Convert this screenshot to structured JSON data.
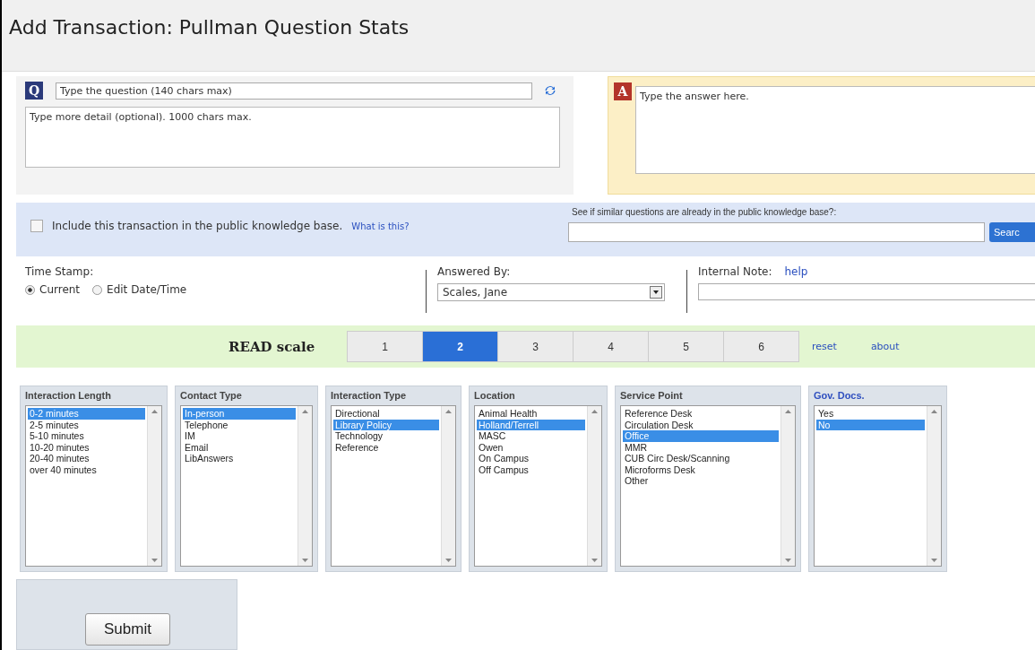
{
  "title": "Add Transaction: Pullman Question Stats",
  "question": {
    "badge": "Q",
    "placeholder": "Type the question (140 chars max)",
    "detail_placeholder": "Type more detail (optional). 1000 chars max."
  },
  "answer": {
    "badge": "A",
    "placeholder": "Type the answer here."
  },
  "knowledge_base": {
    "label": "Include this transaction in the public knowledge base.",
    "checked": false,
    "link": "What is this?",
    "search_label": "See if similar questions are already in the public knowledge base?:",
    "search_button": "Searc"
  },
  "time_stamp": {
    "label": "Time Stamp:",
    "options": [
      {
        "label": "Current",
        "selected": true
      },
      {
        "label": "Edit Date/Time",
        "selected": false
      }
    ]
  },
  "answered_by": {
    "label": "Answered By:",
    "value": "Scales, Jane"
  },
  "internal_note": {
    "label": "Internal Note:",
    "link": "help"
  },
  "read_scale": {
    "label": "READ scale",
    "options": [
      {
        "label": "1",
        "selected": false
      },
      {
        "label": "2",
        "selected": true
      },
      {
        "label": "3",
        "selected": false
      },
      {
        "label": "4",
        "selected": false
      },
      {
        "label": "5",
        "selected": false
      },
      {
        "label": "6",
        "selected": false
      }
    ],
    "links": [
      "reset",
      "about"
    ]
  },
  "lists": [
    {
      "title": "Interaction Length",
      "highlighted": false,
      "items": [
        {
          "label": "0-2 minutes",
          "selected": true
        },
        {
          "label": "2-5 minutes",
          "selected": false
        },
        {
          "label": "5-10 minutes",
          "selected": false
        },
        {
          "label": "10-20 minutes",
          "selected": false
        },
        {
          "label": "20-40 minutes",
          "selected": false
        },
        {
          "label": "over 40 minutes",
          "selected": false
        }
      ]
    },
    {
      "title": "Contact Type",
      "highlighted": false,
      "items": [
        {
          "label": "In-person",
          "selected": true
        },
        {
          "label": "Telephone",
          "selected": false
        },
        {
          "label": "IM",
          "selected": false
        },
        {
          "label": "Email",
          "selected": false
        },
        {
          "label": "LibAnswers",
          "selected": false
        }
      ]
    },
    {
      "title": "Interaction Type",
      "highlighted": false,
      "items": [
        {
          "label": "Directional",
          "selected": false
        },
        {
          "label": "Library Policy",
          "selected": true
        },
        {
          "label": "Technology",
          "selected": false
        },
        {
          "label": "Reference",
          "selected": false
        }
      ]
    },
    {
      "title": "Location",
      "highlighted": false,
      "items": [
        {
          "label": "Animal Health",
          "selected": false
        },
        {
          "label": "Holland/Terrell",
          "selected": true
        },
        {
          "label": "MASC",
          "selected": false
        },
        {
          "label": "Owen",
          "selected": false
        },
        {
          "label": "On Campus",
          "selected": false
        },
        {
          "label": "Off Campus",
          "selected": false
        }
      ]
    },
    {
      "title": "Service Point",
      "highlighted": false,
      "items": [
        {
          "label": "Reference Desk",
          "selected": false
        },
        {
          "label": "Circulation Desk",
          "selected": false
        },
        {
          "label": "Office",
          "selected": true
        },
        {
          "label": "MMR",
          "selected": false
        },
        {
          "label": "CUB Circ Desk/Scanning",
          "selected": false
        },
        {
          "label": "Microforms Desk",
          "selected": false
        },
        {
          "label": "Other",
          "selected": false
        }
      ]
    },
    {
      "title": "Gov. Docs.",
      "highlighted": true,
      "items": [
        {
          "label": "Yes",
          "selected": false
        },
        {
          "label": "No",
          "selected": true
        }
      ]
    }
  ],
  "submit": "Submit"
}
